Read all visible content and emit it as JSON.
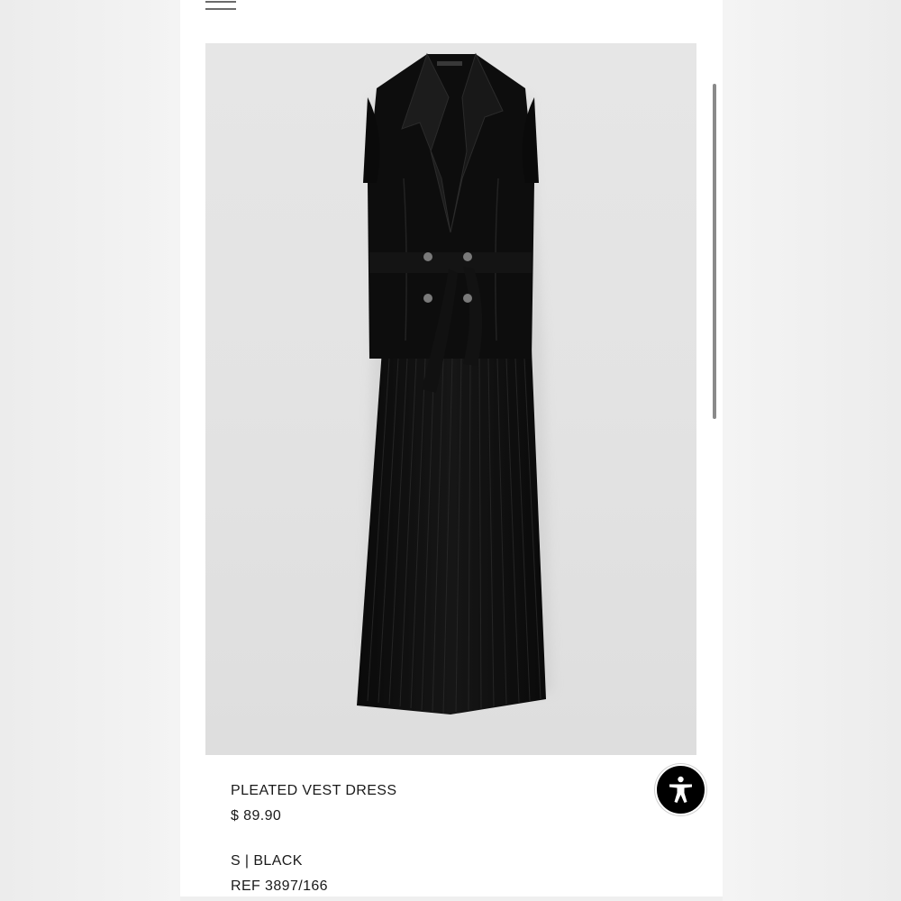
{
  "header": {
    "menu_icon": "hamburger-menu-icon"
  },
  "product": {
    "image_alt": "pleated-vest-dress-photo",
    "name": "PLEATED VEST DRESS",
    "price": "$ 89.90",
    "variant": "S | BLACK",
    "ref": "REF 3897/166",
    "color": "#0d0d0d"
  },
  "accessibility": {
    "icon": "accessibility-person-icon",
    "color": "#000000"
  },
  "colors": {
    "page_background": "#ffffff",
    "image_background": "#e4e4e4",
    "text": "#1a1a1a"
  }
}
